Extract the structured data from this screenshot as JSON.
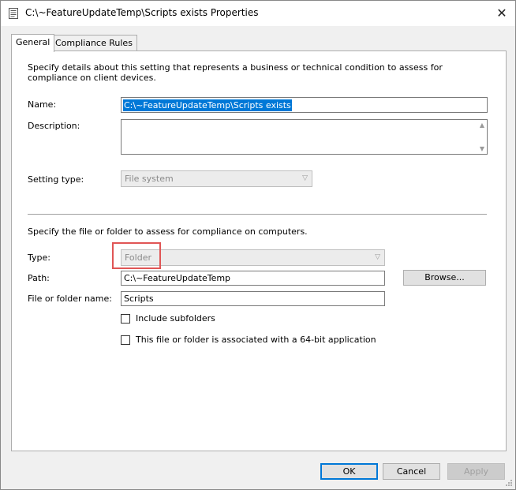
{
  "window": {
    "title": "C:\\~FeatureUpdateTemp\\Scripts exists Properties",
    "close_glyph": "✕",
    "icon": "properties-window-icon"
  },
  "tabs": [
    {
      "label": "General",
      "active": true
    },
    {
      "label": "Compliance Rules",
      "active": false
    }
  ],
  "general": {
    "description": "Specify details about this setting that represents a business or technical condition to assess for compliance on client devices.",
    "name_label": "Name:",
    "name_value": "C:\\~FeatureUpdateTemp\\Scripts exists",
    "description_label": "Description:",
    "description_value": "",
    "setting_type_label": "Setting type:",
    "setting_type_value": "File system",
    "file_section_text": "Specify the file or folder to assess for compliance on computers.",
    "type_label": "Type:",
    "type_value": "Folder",
    "path_label": "Path:",
    "path_value": "C:\\~FeatureUpdateTemp",
    "browse_label": "Browse...",
    "file_name_label": "File or folder name:",
    "file_name_value": "Scripts",
    "include_subfolders_label": "Include subfolders",
    "include_subfolders_checked": false,
    "is64bit_label": "This file or folder is associated with a 64-bit application",
    "is64bit_checked": false
  },
  "footer": {
    "ok_label": "OK",
    "cancel_label": "Cancel",
    "apply_label": "Apply"
  },
  "colors": {
    "selection": "#0078d7",
    "highlight_box": "#e05555",
    "default_button_border": "#0078d7"
  }
}
